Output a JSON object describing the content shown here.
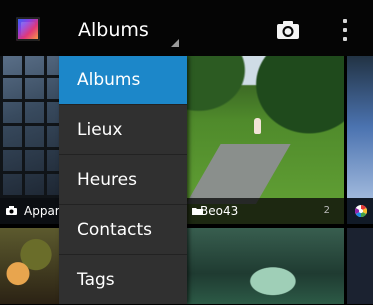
{
  "action_bar": {
    "app_icon": "gallery-app-icon",
    "spinner_title": "Albums",
    "camera_icon": "camera-icon",
    "overflow_icon": "overflow-menu-icon"
  },
  "albums": [
    {
      "label": "Appare",
      "icon": "camera-icon",
      "count": ""
    },
    {
      "label": "Beo43",
      "icon": "folder-icon",
      "count": "2"
    },
    {
      "label": "",
      "icon": "picasa-icon",
      "count": ""
    }
  ],
  "menu": {
    "selected_index": 0,
    "items": [
      {
        "label": "Albums"
      },
      {
        "label": "Lieux"
      },
      {
        "label": "Heures"
      },
      {
        "label": "Contacts"
      },
      {
        "label": "Tags"
      }
    ]
  },
  "colors": {
    "accent": "#1c87c9",
    "menu_background": "#303030",
    "action_bar": "#050505"
  }
}
